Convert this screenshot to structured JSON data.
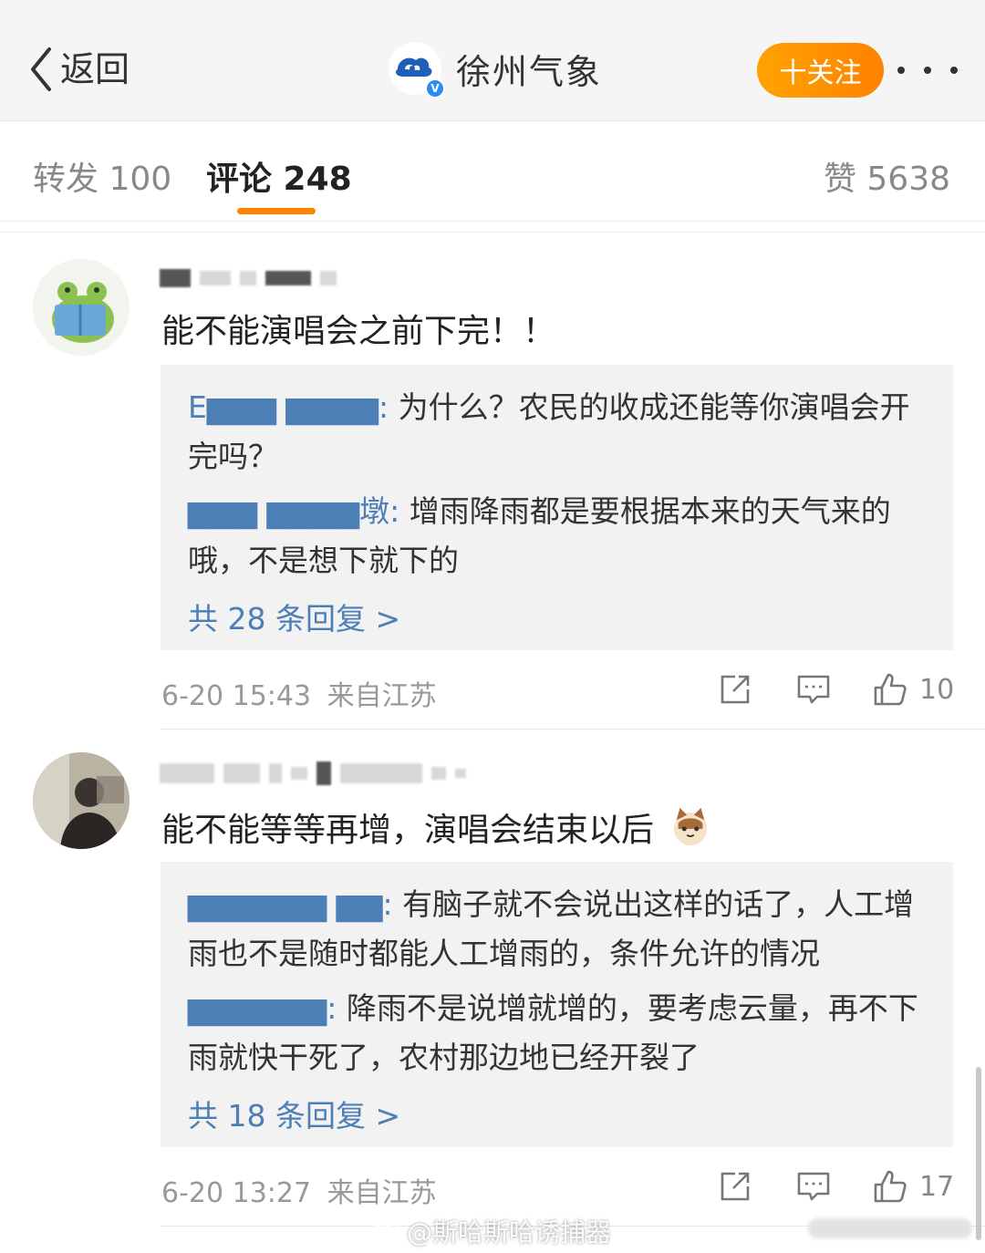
{
  "header": {
    "back_label": "返回",
    "account_name": "徐州气象",
    "verified_mark": "V",
    "follow_label": "十关注"
  },
  "tabs": {
    "repost": "转发 100",
    "comments": "评论 248",
    "likes": "赞 5638"
  },
  "comments": [
    {
      "text": "能不能演唱会之前下完！！",
      "replies": [
        {
          "user": "E▆▆▆ ▆▆▆▆:",
          "text": " 为什么？农民的收成还能等你演唱会开完吗？"
        },
        {
          "user": "▆▆▆ ▆▆▆▆墩:",
          "text": " 增雨降雨都是要根据本来的天气来的哦，不是想下就下的"
        }
      ],
      "more_replies": "共 28 条回复 >",
      "time": "6-20 15:43",
      "location": "来自江苏",
      "like_count": "10"
    },
    {
      "text": "能不能等等再增，演唱会结束以后",
      "replies": [
        {
          "user": "▆▆▆▆▆▆ ▆▆:",
          "text": " 有脑子就不会说出这样的话了，人工增雨也不是随时都能人工增雨的，条件允许的情况"
        },
        {
          "user": "▆▆▆▆▆▆:",
          "text": " 降雨不是说增就增的，要考虑云量，再不下雨就快干死了，农村那边地已经开裂了"
        }
      ],
      "more_replies": "共 18 条回复 >",
      "time": "6-20 13:27",
      "location": "来自江苏",
      "like_count": "17"
    }
  ],
  "watermark": "@斯哈斯哈诱捕器",
  "colors": {
    "accent": "#ff8200",
    "link": "#4b7fb6",
    "reply_bg": "#f2f2f2"
  }
}
